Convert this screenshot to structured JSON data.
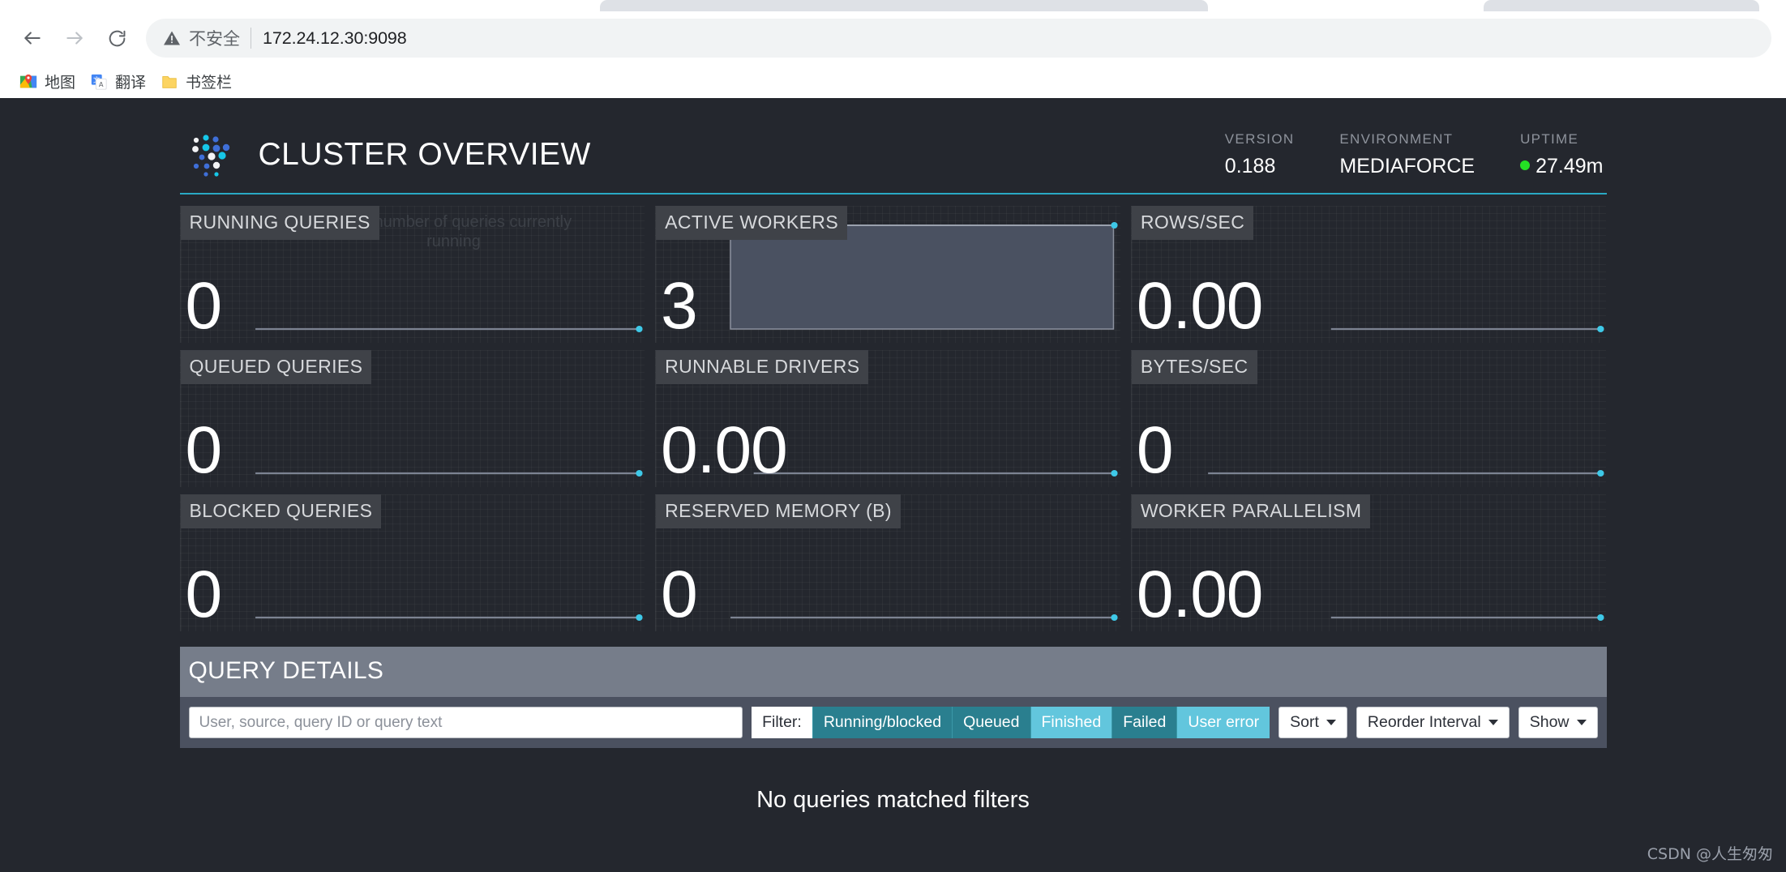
{
  "browser": {
    "back_icon": "back-arrow-icon",
    "forward_icon": "forward-arrow-icon",
    "reload_icon": "reload-icon",
    "security_warning_label": "不安全",
    "url": "172.24.12.30:9098",
    "bookmarks": [
      {
        "label": "地图",
        "icon": "maps-icon"
      },
      {
        "label": "翻译",
        "icon": "translate-icon"
      },
      {
        "label": "书签栏",
        "icon": "folder-icon"
      }
    ]
  },
  "header": {
    "title": "CLUSTER OVERVIEW",
    "logo_icon": "presto-dots-logo-icon",
    "meta": [
      {
        "label": "VERSION",
        "value": "0.188",
        "status_dot": false
      },
      {
        "label": "ENVIRONMENT",
        "value": "MEDIAFORCE",
        "status_dot": false
      },
      {
        "label": "UPTIME",
        "value": "27.49m",
        "status_dot": true
      }
    ],
    "accent_color": "#2aa9c4",
    "status_dot_color": "#24e024"
  },
  "metrics": [
    {
      "label": "RUNNING QUERIES",
      "value": "0",
      "tooltip": "Total number of queries currently running",
      "spark": "line"
    },
    {
      "label": "ACTIVE WORKERS",
      "value": "3",
      "tooltip": "",
      "spark": "area"
    },
    {
      "label": "ROWS/SEC",
      "value": "0.00",
      "tooltip": "",
      "spark": "line-right"
    },
    {
      "label": "QUEUED QUERIES",
      "value": "0",
      "tooltip": "",
      "spark": "line"
    },
    {
      "label": "RUNNABLE DRIVERS",
      "value": "0.00",
      "tooltip": "",
      "spark": "line"
    },
    {
      "label": "BYTES/SEC",
      "value": "0",
      "tooltip": "",
      "spark": "line"
    },
    {
      "label": "BLOCKED QUERIES",
      "value": "0",
      "tooltip": "",
      "spark": "line"
    },
    {
      "label": "RESERVED MEMORY (B)",
      "value": "0",
      "tooltip": "",
      "spark": "line"
    },
    {
      "label": "WORKER PARALLELISM",
      "value": "0.00",
      "tooltip": "",
      "spark": "line-right"
    }
  ],
  "query_details": {
    "heading": "QUERY DETAILS",
    "search_placeholder": "User, source, query ID or query text",
    "search_value": "",
    "filter_label": "Filter:",
    "filters": [
      {
        "label": "Running/blocked",
        "active": false
      },
      {
        "label": "Queued",
        "active": false
      },
      {
        "label": "Finished",
        "active": true
      },
      {
        "label": "Failed",
        "active": false
      },
      {
        "label": "User error",
        "active": true
      }
    ],
    "dropdowns": [
      {
        "label": "Sort"
      },
      {
        "label": "Reorder Interval"
      },
      {
        "label": "Show"
      }
    ],
    "empty_message": "No queries matched filters"
  },
  "watermark": "CSDN @人生匆匆"
}
